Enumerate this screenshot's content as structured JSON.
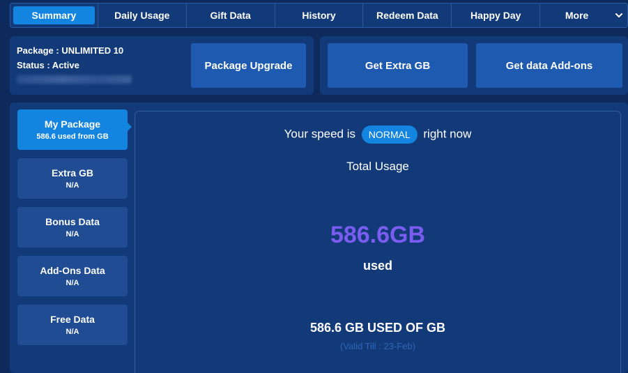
{
  "nav": {
    "tabs": [
      {
        "label": "Summary"
      },
      {
        "label": "Daily Usage"
      },
      {
        "label": "Gift Data"
      },
      {
        "label": "History"
      },
      {
        "label": "Redeem Data"
      },
      {
        "label": "Happy Day"
      },
      {
        "label": "More"
      }
    ]
  },
  "info": {
    "package": "Package : UNLIMITED 10",
    "status": "Status : Active"
  },
  "buttons": {
    "upgrade": "Package Upgrade",
    "extra_gb": "Get Extra GB",
    "addons": "Get data Add-ons"
  },
  "sidebar": {
    "items": [
      {
        "title": "My Package",
        "sub": "586.6 used from GB"
      },
      {
        "title": "Extra GB",
        "sub": "N/A"
      },
      {
        "title": "Bonus Data",
        "sub": "N/A"
      },
      {
        "title": "Add-Ons Data",
        "sub": "N/A"
      },
      {
        "title": "Free Data",
        "sub": "N/A"
      }
    ]
  },
  "content": {
    "speed_prefix": "Your speed is",
    "speed_status": "NORMAL",
    "speed_suffix": "right now",
    "total_label": "Total Usage",
    "usage_value": "586.6GB",
    "usage_label": "used",
    "summary": "586.6 GB USED OF GB",
    "valid": "(Valid Till : 23-Feb)"
  },
  "colors": {
    "accent": "#1384e0",
    "usage_value": "#7a5cf0",
    "background": "#0e2a5c"
  }
}
